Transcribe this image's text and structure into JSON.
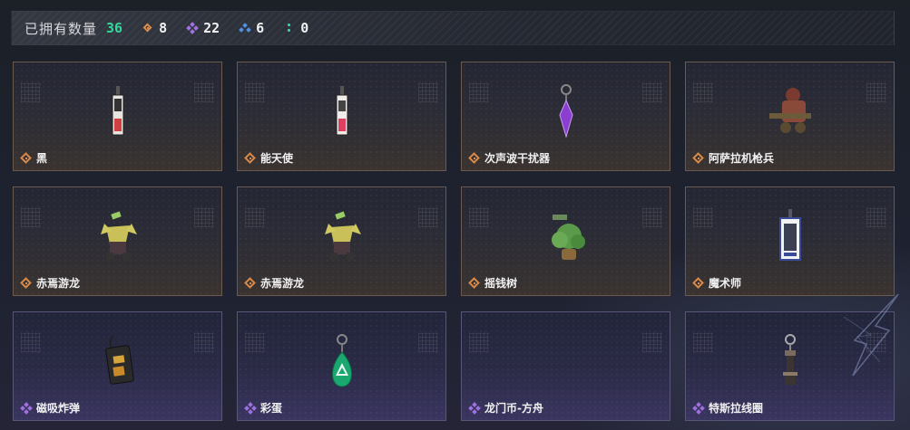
{
  "header": {
    "label": "已拥有数量",
    "count": "36",
    "stats": [
      {
        "icon": "orange-diamond-icon",
        "value": "8",
        "color": "#d98a4a"
      },
      {
        "icon": "purple-diamond-cluster-icon",
        "value": "22",
        "color": "#a070e0"
      },
      {
        "icon": "blue-triangle-cluster-icon",
        "value": "6",
        "color": "#4a8fe0"
      },
      {
        "icon": "green-dots-icon",
        "value": "0",
        "color": "#2fd89a"
      }
    ]
  },
  "items": [
    {
      "name": "黑",
      "rarity": "orange",
      "art": "tag-charm"
    },
    {
      "name": "能天使",
      "rarity": "orange",
      "art": "tag-charm-red"
    },
    {
      "name": "次声波干扰器",
      "rarity": "orange",
      "art": "crystal-charm"
    },
    {
      "name": "阿萨拉机枪兵",
      "rarity": "orange",
      "art": "gunner-figure"
    },
    {
      "name": "赤焉游龙",
      "rarity": "orange",
      "art": "dragon-figure"
    },
    {
      "name": "赤焉游龙",
      "rarity": "orange",
      "art": "dragon-figure"
    },
    {
      "name": "摇钱树",
      "rarity": "orange",
      "art": "money-tree"
    },
    {
      "name": "魔术师",
      "rarity": "orange",
      "art": "magician-card"
    },
    {
      "name": "磁吸炸弹",
      "rarity": "purple",
      "art": "bomb-charm"
    },
    {
      "name": "彩蛋",
      "rarity": "purple",
      "art": "egg-charm"
    },
    {
      "name": "龙门币-方舟",
      "rarity": "purple",
      "art": "empty"
    },
    {
      "name": "特斯拉线圈",
      "rarity": "purple",
      "art": "coil-charm"
    }
  ]
}
